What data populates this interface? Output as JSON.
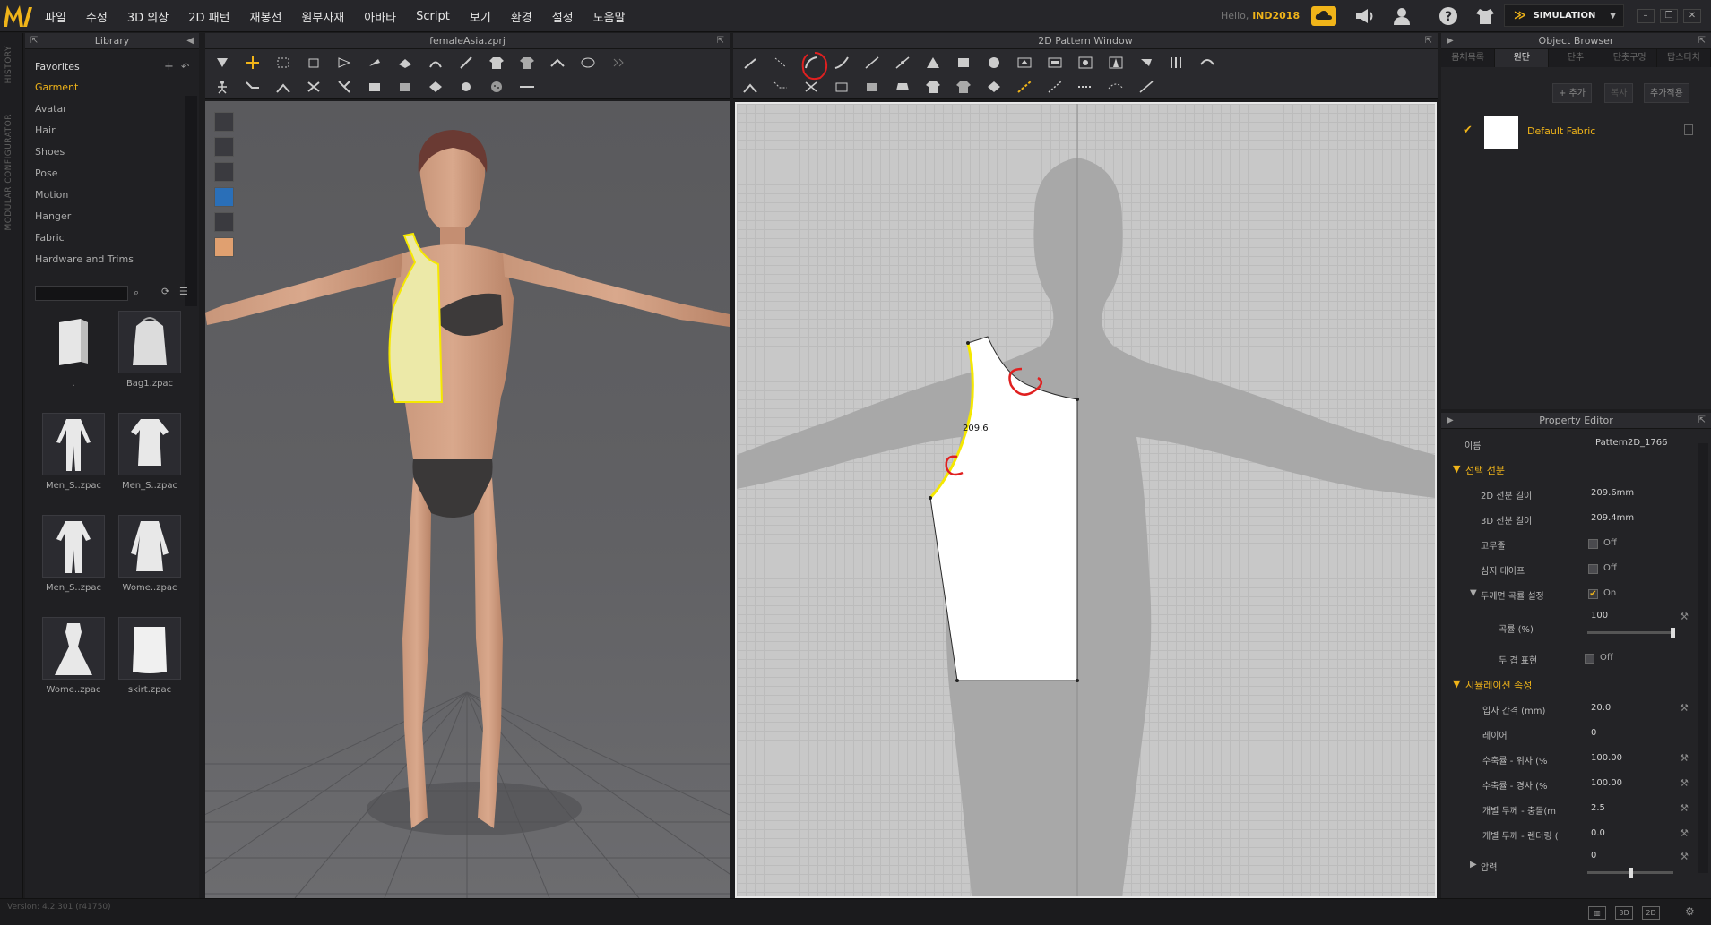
{
  "menubar": {
    "menus": [
      "파일",
      "수정",
      "3D 의상",
      "2D 패턴",
      "재봉선",
      "원부자재",
      "아바타",
      "Script",
      "보기",
      "환경",
      "설정",
      "도움말"
    ],
    "hello_prefix": "Hello,",
    "user_name": "iND2018",
    "simulation_label": "SIMULATION"
  },
  "side_tabs": [
    "HISTORY",
    "MODULAR CONFIGURATOR"
  ],
  "library": {
    "title": "Library",
    "favorites_label": "Favorites",
    "items": [
      "Garment",
      "Avatar",
      "Hair",
      "Shoes",
      "Pose",
      "Motion",
      "Hanger",
      "Fabric",
      "Hardware and Trims"
    ],
    "active_item": "Garment",
    "search_value": "",
    "thumbnails": [
      ".",
      "Bag1.zpac",
      "Men_S..zpac",
      "Men_S..zpac",
      "Men_S..zpac",
      "Wome..zpac",
      "Wome..zpac",
      "skirt.zpac"
    ]
  },
  "view3d": {
    "title": "femaleAsia.zprj"
  },
  "view2d": {
    "title": "2D Pattern Window",
    "measure_label": "209.6"
  },
  "object_browser": {
    "title": "Object Browser",
    "tabs": [
      "몸체목록",
      "원단",
      "단추",
      "단춧구멍",
      "탑스티치"
    ],
    "active_tab": "원단",
    "add_label": "+ 추가",
    "copy_label": "복사",
    "apply_label": "추가적용",
    "fabric_name": "Default Fabric"
  },
  "property_editor": {
    "title": "Property Editor",
    "name_label": "이름",
    "name_value": "Pattern2D_1766",
    "section_selected_line": "선택 선분",
    "len2d_label": "2D 선분 길이",
    "len2d_value": "209.6mm",
    "len3d_label": "3D 선분 길이",
    "len3d_value": "209.4mm",
    "elastic_label": "고무줄",
    "elastic_value": "Off",
    "tape_label": "심지 테이프",
    "tape_value": "Off",
    "curve_label": "두께면 곡률 설정",
    "curve_value": "On",
    "curvature_label": "곡률 (%)",
    "curvature_value": "100",
    "double_label": "두 겹 표현",
    "double_value": "Off",
    "section_simulation": "시뮬레이션 속성",
    "particle_label": "입자 간격 (mm)",
    "particle_value": "20.0",
    "layer_label": "레이어",
    "layer_value": "0",
    "shrink_weft_label": "수축률 - 위사 (%",
    "shrink_weft_value": "100.00",
    "shrink_warp_label": "수축률 - 경사 (%",
    "shrink_warp_value": "100.00",
    "thick_collision_label": "개별 두께 - 충돌(m",
    "thick_collision_value": "2.5",
    "thick_render_label": "개별 두께 - 렌더링 (",
    "thick_render_value": "0.0",
    "pressure_label": "압력",
    "pressure_value": "0"
  },
  "status": {
    "version": "Version: 4.2.301 (r41750)"
  },
  "colors": {
    "accent": "#f0b419",
    "selected_line": "#f5e800",
    "pattern_fill_3d": "#ece9a8",
    "annotation": "#e02020"
  }
}
